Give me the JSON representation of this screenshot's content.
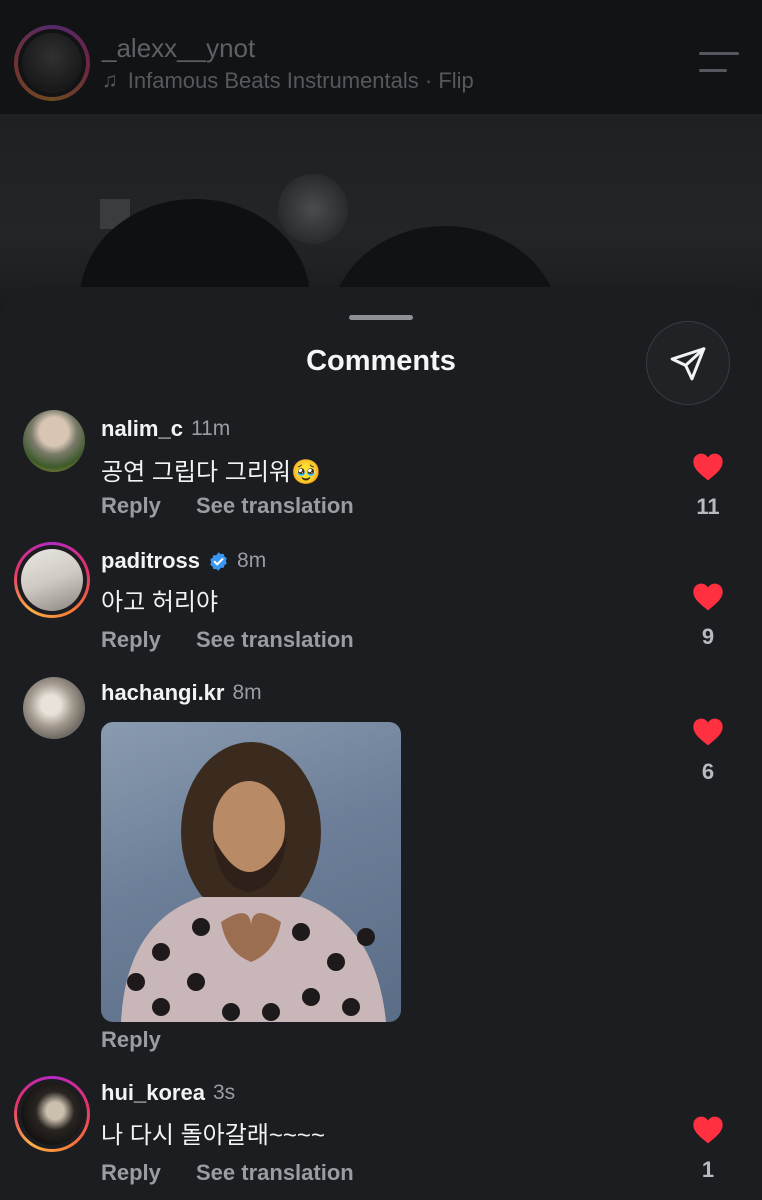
{
  "post_header": {
    "username": "_alexx__ynot",
    "music_title": "Infamous Beats Instrumentals · Flip",
    "music_icon": "♫"
  },
  "comments_sheet": {
    "title": "Comments"
  },
  "comments": [
    {
      "username": "nalim_c",
      "time": "11m",
      "text": "공연 그립다 그리워🥹",
      "reply_label": "Reply",
      "translate_label": "See translation",
      "likes": "11"
    },
    {
      "username": "paditross",
      "time": "8m",
      "text": "아고 허리야",
      "reply_label": "Reply",
      "translate_label": "See translation",
      "likes": "9"
    },
    {
      "username": "hachangi.kr",
      "time": "8m",
      "reply_label": "Reply",
      "likes": "6"
    },
    {
      "username": "hui_korea",
      "time": "3s",
      "text": "나 다시 돌아갈래~~~~",
      "reply_label": "Reply",
      "translate_label": "See translation",
      "likes": "1"
    }
  ],
  "colors": {
    "heart": "#ff3040",
    "verified": "#3897f0",
    "sheet_bg": "#1c1d20"
  }
}
